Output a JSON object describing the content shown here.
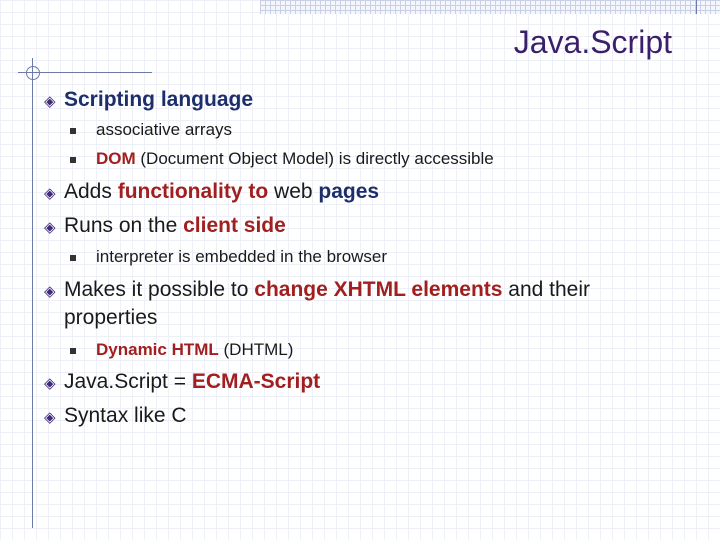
{
  "slide": {
    "title": "Java.Script",
    "items": [
      {
        "text": "Scripting language"
      },
      {
        "text": "associative arrays"
      },
      {
        "t1": "DOM",
        "t2": " (Document Object Model) is directly accessible"
      },
      {
        "t1": "Adds ",
        "t2": "functionality to",
        "t3": " web ",
        "t4": "pages"
      },
      {
        "t1": "Runs on the ",
        "t2": "client side"
      },
      {
        "text": "interpreter is embedded in the browser"
      },
      {
        "t1": "Makes it possible to ",
        "t2": "change XHTML elements",
        "t3": " and their",
        "t4": "properties"
      },
      {
        "t1": "Dynamic HTML",
        "t2": " (DHTML)"
      },
      {
        "t1": "Java.Script = ",
        "t2": "ECMA-Script"
      },
      {
        "text": "Syntax like C"
      }
    ]
  },
  "colors": {
    "title": "#3b1f6b",
    "accent": "#a11f1f",
    "bullet": "#3d2a78"
  }
}
